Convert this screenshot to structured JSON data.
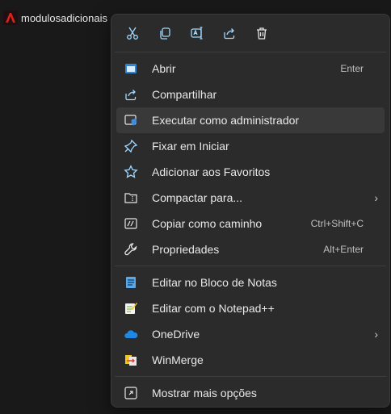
{
  "file": {
    "name": "modulosadicionais",
    "icon": "acrobat-icon"
  },
  "toolbar": [
    {
      "name": "cut-button",
      "icon": "scissors-icon"
    },
    {
      "name": "copy-button",
      "icon": "copy-icon"
    },
    {
      "name": "rename-button",
      "icon": "rename-icon"
    },
    {
      "name": "share-button",
      "icon": "share-icon"
    },
    {
      "name": "delete-button",
      "icon": "trash-icon"
    }
  ],
  "menu": {
    "abrir": {
      "label": "Abrir",
      "shortcut": "Enter"
    },
    "compartilhar": {
      "label": "Compartilhar"
    },
    "executar": {
      "label": "Executar como administrador"
    },
    "fixar": {
      "label": "Fixar em Iniciar"
    },
    "favoritos": {
      "label": "Adicionar aos Favoritos"
    },
    "compactar": {
      "label": "Compactar para..."
    },
    "copiar_caminho": {
      "label": "Copiar como caminho",
      "shortcut": "Ctrl+Shift+C"
    },
    "propriedades": {
      "label": "Propriedades",
      "shortcut": "Alt+Enter"
    },
    "bloco_notas": {
      "label": "Editar no Bloco de Notas"
    },
    "notepadpp": {
      "label": "Editar com o Notepad++"
    },
    "onedrive": {
      "label": "OneDrive"
    },
    "winmerge": {
      "label": "WinMerge"
    },
    "mais_opcoes": {
      "label": "Mostrar mais opções"
    }
  },
  "colors": {
    "accent": "#60cdff",
    "menu_bg": "#2b2b2b",
    "hover": "#393939"
  }
}
